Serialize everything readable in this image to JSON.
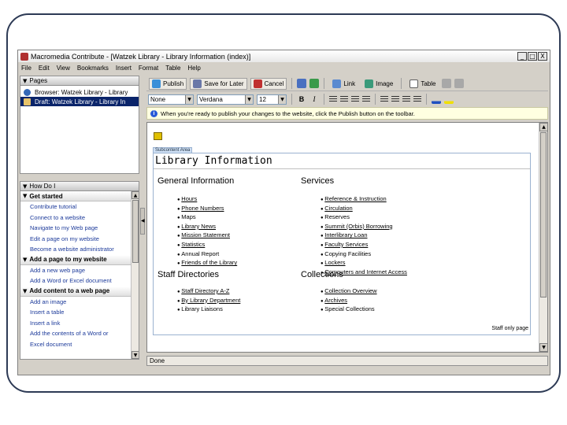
{
  "window": {
    "title": "Macromedia Contribute - [Watzek Library - Library Information (index)]",
    "buttons": {
      "minimize": "_",
      "restore": "□",
      "close": "X"
    }
  },
  "menu": [
    "File",
    "Edit",
    "View",
    "Bookmarks",
    "Insert",
    "Format",
    "Table",
    "Help"
  ],
  "pages_panel": {
    "header": "Pages",
    "items": [
      {
        "label": "Browser: Watzek Library - Library",
        "selected": false
      },
      {
        "label": "Draft: Watzek Library - Library In",
        "selected": true
      }
    ]
  },
  "howdoi_panel": {
    "header": "How Do I",
    "sections": [
      {
        "title": "Get started",
        "links": [
          "Contribute tutorial",
          "Connect to a website",
          "Navigate to my Web page",
          "Edit a page on my website",
          "Become a website administrator"
        ]
      },
      {
        "title": "Add a page to my website",
        "links": [
          "Add a new web page",
          "Add a Word or Excel document"
        ]
      },
      {
        "title": "Add content to a web page",
        "links": [
          "Add an image",
          "Insert a table",
          "Insert a link",
          "Add the contents of a Word or",
          "Excel document"
        ]
      }
    ]
  },
  "toolbar": {
    "publish": "Publish",
    "save_for_later": "Save for Later",
    "cancel": "Cancel",
    "link": "Link",
    "image": "Image",
    "table": "Table"
  },
  "format_bar": {
    "style": "None",
    "font": "Verdana",
    "size": "12",
    "bold": "B",
    "italic": "I"
  },
  "infobar": "When you're ready to publish your changes to the website, click the Publish button on the toolbar.",
  "document": {
    "editable_label": "Subcontent Area",
    "title": "Library Information",
    "sections": [
      {
        "heading": "General Information",
        "items": [
          {
            "text": "Hours",
            "link": true
          },
          {
            "text": "Phone Numbers",
            "link": true
          },
          {
            "text": "Maps",
            "link": false
          },
          {
            "text": "Library News",
            "link": true
          },
          {
            "text": "Mission Statement",
            "link": true
          },
          {
            "text": "Statistics",
            "link": true
          },
          {
            "text": "Annual Report",
            "link": false
          },
          {
            "text": "Friends of the Library",
            "link": true
          }
        ]
      },
      {
        "heading": "Services",
        "items": [
          {
            "text": "Reference & Instruction",
            "link": true
          },
          {
            "text": "Circulation",
            "link": true
          },
          {
            "text": "Reserves",
            "link": false
          },
          {
            "text": "Summit (Orbis) Borrowing",
            "link": true
          },
          {
            "text": "Interlibrary Loan",
            "link": true
          },
          {
            "text": "Faculty Services",
            "link": true
          },
          {
            "text": "Copying Facilities",
            "link": false
          },
          {
            "text": "Lockers",
            "link": true
          },
          {
            "text": "Computers and Internet Access",
            "link": true
          }
        ]
      },
      {
        "heading": "Staff Directories",
        "items": [
          {
            "text": "Staff Directory A-Z",
            "link": true
          },
          {
            "text": "By Library Department",
            "link": true
          },
          {
            "text": "Library Liaisons",
            "link": false
          }
        ]
      },
      {
        "heading": "Collections",
        "items": [
          {
            "text": "Collection Overview",
            "link": true
          },
          {
            "text": "Archives",
            "link": true
          },
          {
            "text": "Special Collections",
            "link": false
          }
        ]
      }
    ],
    "staff_only": "Staff only page"
  },
  "status": "Done"
}
